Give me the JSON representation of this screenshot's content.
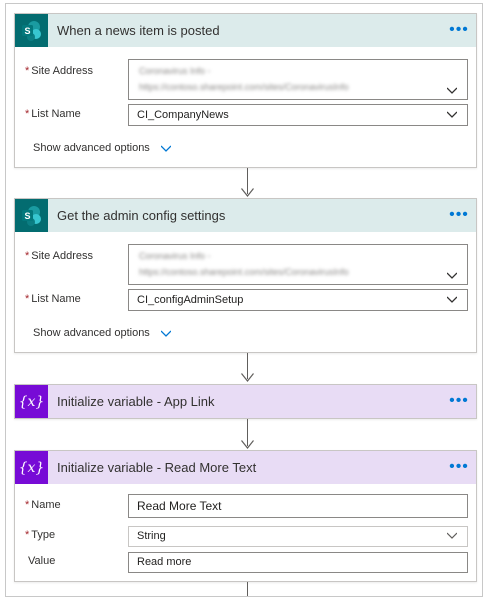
{
  "steps": [
    {
      "title": "When a news item is posted",
      "site_label": "Site Address",
      "site_line1": "Coronavirus Info -",
      "site_line2": "https://contoso.sharepoint.com/sites/CoronavirusInfo",
      "list_label": "List Name",
      "list_value": "CI_CompanyNews",
      "advanced_label": "Show advanced options"
    },
    {
      "title": "Get the admin config settings",
      "site_label": "Site Address",
      "site_line1": "Coronavirus Info -",
      "site_line2": "https://contoso.sharepoint.com/sites/CoronavirusInfo",
      "list_label": "List Name",
      "list_value": "CI_configAdminSetup",
      "advanced_label": "Show advanced options"
    },
    {
      "title": "Initialize variable - App Link"
    },
    {
      "title": "Initialize variable - Read More Text",
      "name_label": "Name",
      "name_value": "Read More Text",
      "type_label": "Type",
      "type_value": "String",
      "value_label": "Value",
      "value_value": "Read more"
    }
  ],
  "icons": {
    "sharepoint": "sharepoint-icon",
    "variable": "variable-icon",
    "more": "more-options-icon",
    "dropdown": "chevron-down-icon"
  },
  "more_glyph": "•••",
  "variable_glyph": "{x}",
  "colors": {
    "sharepoint_header": "#dcebeb",
    "sharepoint_icon": "#036c70",
    "variable_header": "#e8dcf5",
    "variable_icon": "#770bd6",
    "accent": "#0078d4",
    "required": "#a4262c"
  }
}
